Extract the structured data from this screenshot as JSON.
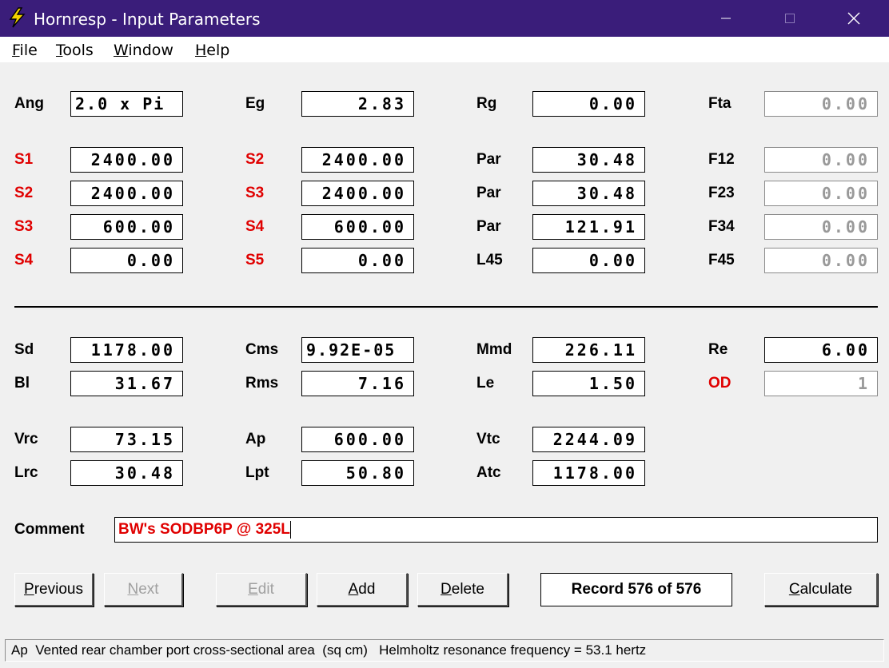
{
  "window": {
    "title": "Hornresp - Input Parameters",
    "minimize": "—",
    "maximize": "☐",
    "close": "✕"
  },
  "menu": [
    {
      "key": "F",
      "rest": "ile"
    },
    {
      "key": "T",
      "rest": "ools"
    },
    {
      "key": "W",
      "rest": "indow"
    },
    {
      "key": "H",
      "rest": "elp"
    }
  ],
  "params": {
    "ang": {
      "label": "Ang",
      "value": "2.0 x Pi"
    },
    "eg": {
      "label": "Eg",
      "value": "2.83"
    },
    "rg": {
      "label": "Rg",
      "value": "0.00"
    },
    "fta": {
      "label": "Fta",
      "value": "0.00"
    },
    "r1c1": {
      "label": "S1",
      "value": "2400.00"
    },
    "r1c2": {
      "label": "S2",
      "value": "2400.00"
    },
    "r1c3": {
      "label": "Par",
      "value": "30.48"
    },
    "r1c4": {
      "label": "F12",
      "value": "0.00"
    },
    "r2c1": {
      "label": "S2",
      "value": "2400.00"
    },
    "r2c2": {
      "label": "S3",
      "value": "2400.00"
    },
    "r2c3": {
      "label": "Par",
      "value": "30.48"
    },
    "r2c4": {
      "label": "F23",
      "value": "0.00"
    },
    "r3c1": {
      "label": "S3",
      "value": "600.00"
    },
    "r3c2": {
      "label": "S4",
      "value": "600.00"
    },
    "r3c3": {
      "label": "Par",
      "value": "121.91"
    },
    "r3c4": {
      "label": "F34",
      "value": "0.00"
    },
    "r4c1": {
      "label": "S4",
      "value": "0.00"
    },
    "r4c2": {
      "label": "S5",
      "value": "0.00"
    },
    "r4c3": {
      "label": "L45",
      "value": "0.00"
    },
    "r4c4": {
      "label": "F45",
      "value": "0.00"
    },
    "sd": {
      "label": "Sd",
      "value": "1178.00"
    },
    "cms": {
      "label": "Cms",
      "value": "9.92E-05"
    },
    "mmd": {
      "label": "Mmd",
      "value": "226.11"
    },
    "re": {
      "label": "Re",
      "value": "6.00"
    },
    "bl": {
      "label": "Bl",
      "value": "31.67"
    },
    "rms": {
      "label": "Rms",
      "value": "7.16"
    },
    "le": {
      "label": "Le",
      "value": "1.50"
    },
    "od": {
      "label": "OD",
      "value": "1"
    },
    "vrc": {
      "label": "Vrc",
      "value": "73.15"
    },
    "ap": {
      "label": "Ap",
      "value": "600.00"
    },
    "vtc": {
      "label": "Vtc",
      "value": "2244.09"
    },
    "lrc": {
      "label": "Lrc",
      "value": "30.48"
    },
    "lpt": {
      "label": "Lpt",
      "value": "50.80"
    },
    "atc": {
      "label": "Atc",
      "value": "1178.00"
    }
  },
  "comment": {
    "label": "Comment",
    "value": "BW's SODBP6P @ 325L"
  },
  "buttons": {
    "previous": {
      "key": "P",
      "rest": "revious"
    },
    "next": {
      "key": "N",
      "rest": "ext"
    },
    "edit": {
      "key": "E",
      "rest": "dit"
    },
    "add": {
      "key": "A",
      "rest": "dd"
    },
    "delete": {
      "key": "D",
      "rest": "elete"
    },
    "calculate": {
      "key": "C",
      "rest": "alculate"
    }
  },
  "record": "Record 576 of 576",
  "status": "Ap  Vented rear chamber port cross-sectional area  (sq cm)   Helmholtz resonance frequency = 53.1 hertz",
  "colors": {
    "titlebar": "#3a1d7a",
    "red_label": "#e00000",
    "icon": "#f5d400"
  }
}
